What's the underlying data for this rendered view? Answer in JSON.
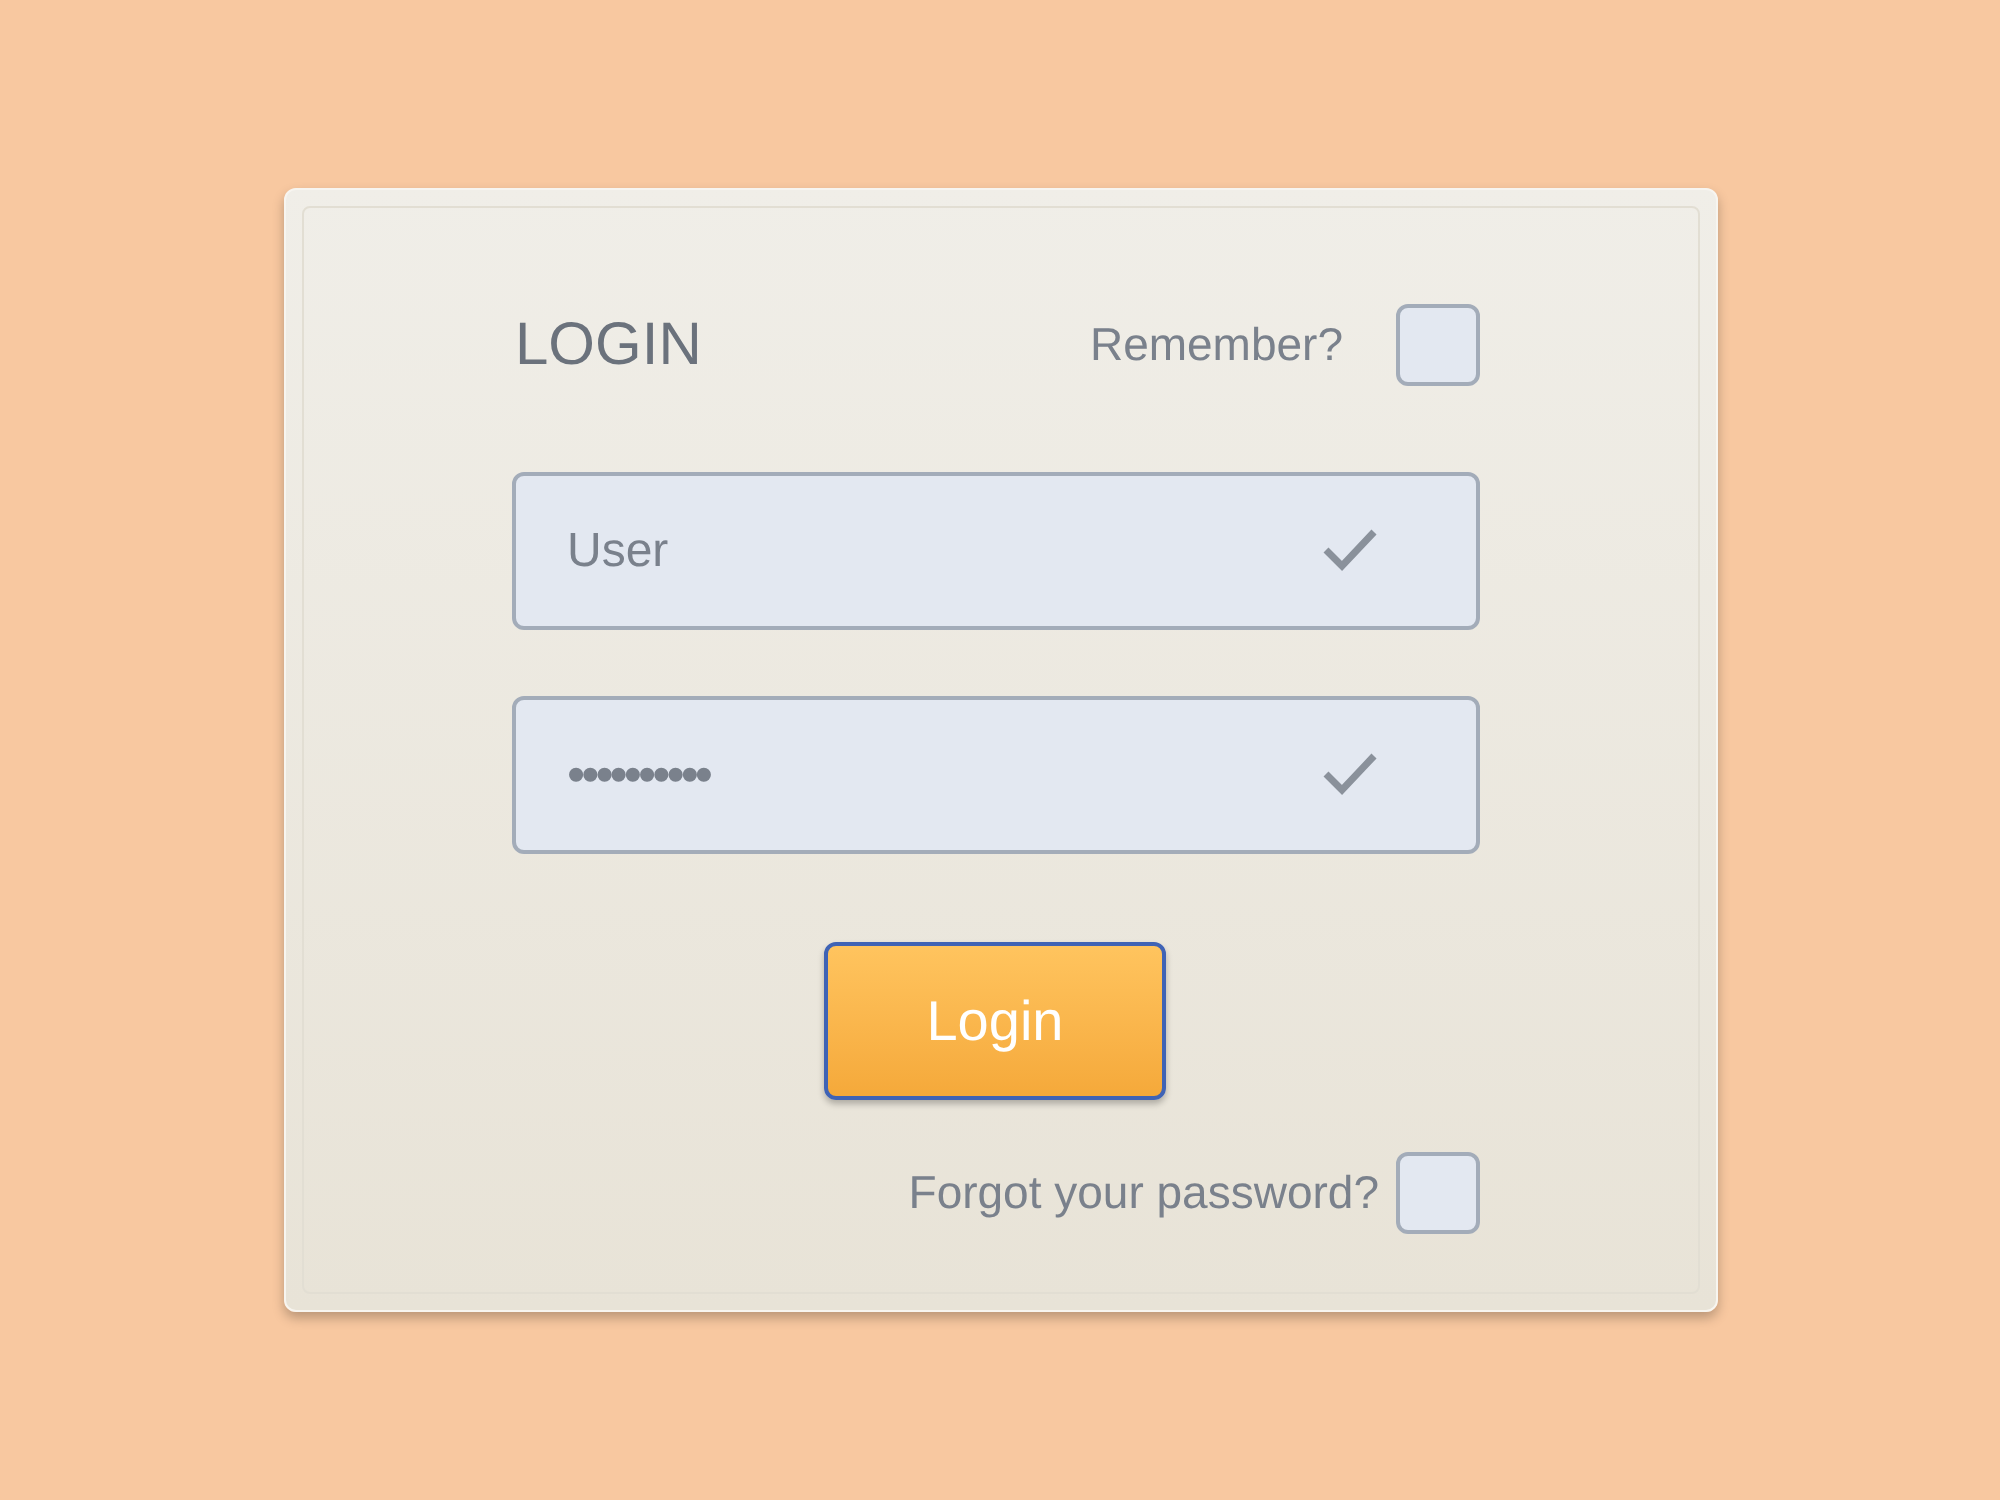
{
  "title": "LOGIN",
  "remember": {
    "label": "Remember?",
    "checked": false
  },
  "fields": [
    {
      "kind": "text",
      "placeholder": "User",
      "verified": true
    },
    {
      "kind": "password",
      "value": "••••••••••",
      "verified": true
    }
  ],
  "login_button": "Login",
  "forgot": {
    "label": "Forgot your password?",
    "checked": false
  }
}
